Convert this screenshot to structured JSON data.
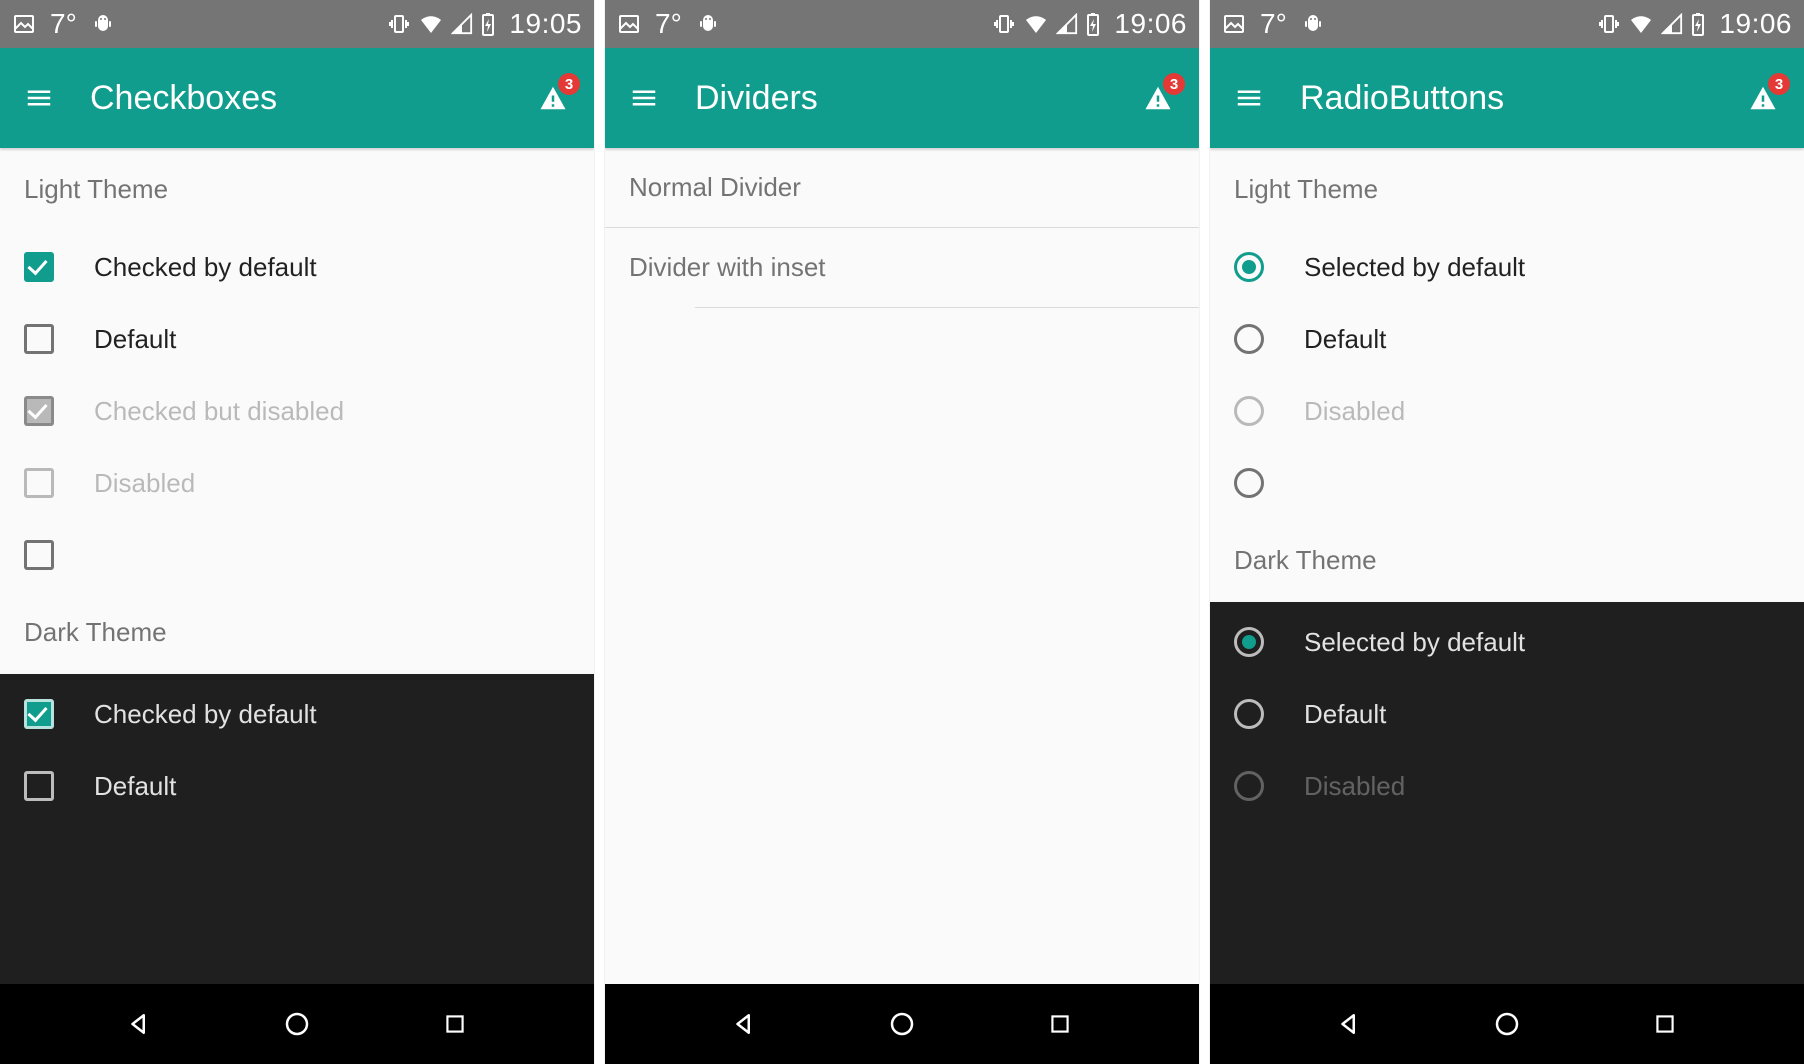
{
  "status": {
    "temp": "7°",
    "time1": "19:05",
    "time2": "19:06",
    "time3": "19:06"
  },
  "badge": "3",
  "screen1": {
    "title": "Checkboxes",
    "light_header": "Light Theme",
    "dark_header": "Dark Theme",
    "items_light": {
      "checked_default": "Checked by default",
      "default": "Default",
      "checked_disabled": "Checked but disabled",
      "disabled": "Disabled"
    },
    "items_dark": {
      "checked_default": "Checked by default",
      "default": "Default"
    }
  },
  "screen2": {
    "title": "Dividers",
    "normal": "Normal Divider",
    "inset": "Divider with inset"
  },
  "screen3": {
    "title": "RadioButtons",
    "light_header": "Light Theme",
    "dark_header": "Dark Theme",
    "items_light": {
      "selected_default": "Selected by default",
      "default": "Default",
      "disabled": "Disabled"
    },
    "items_dark": {
      "selected_default": "Selected by default",
      "default": "Default",
      "disabled": "Disabled"
    }
  }
}
